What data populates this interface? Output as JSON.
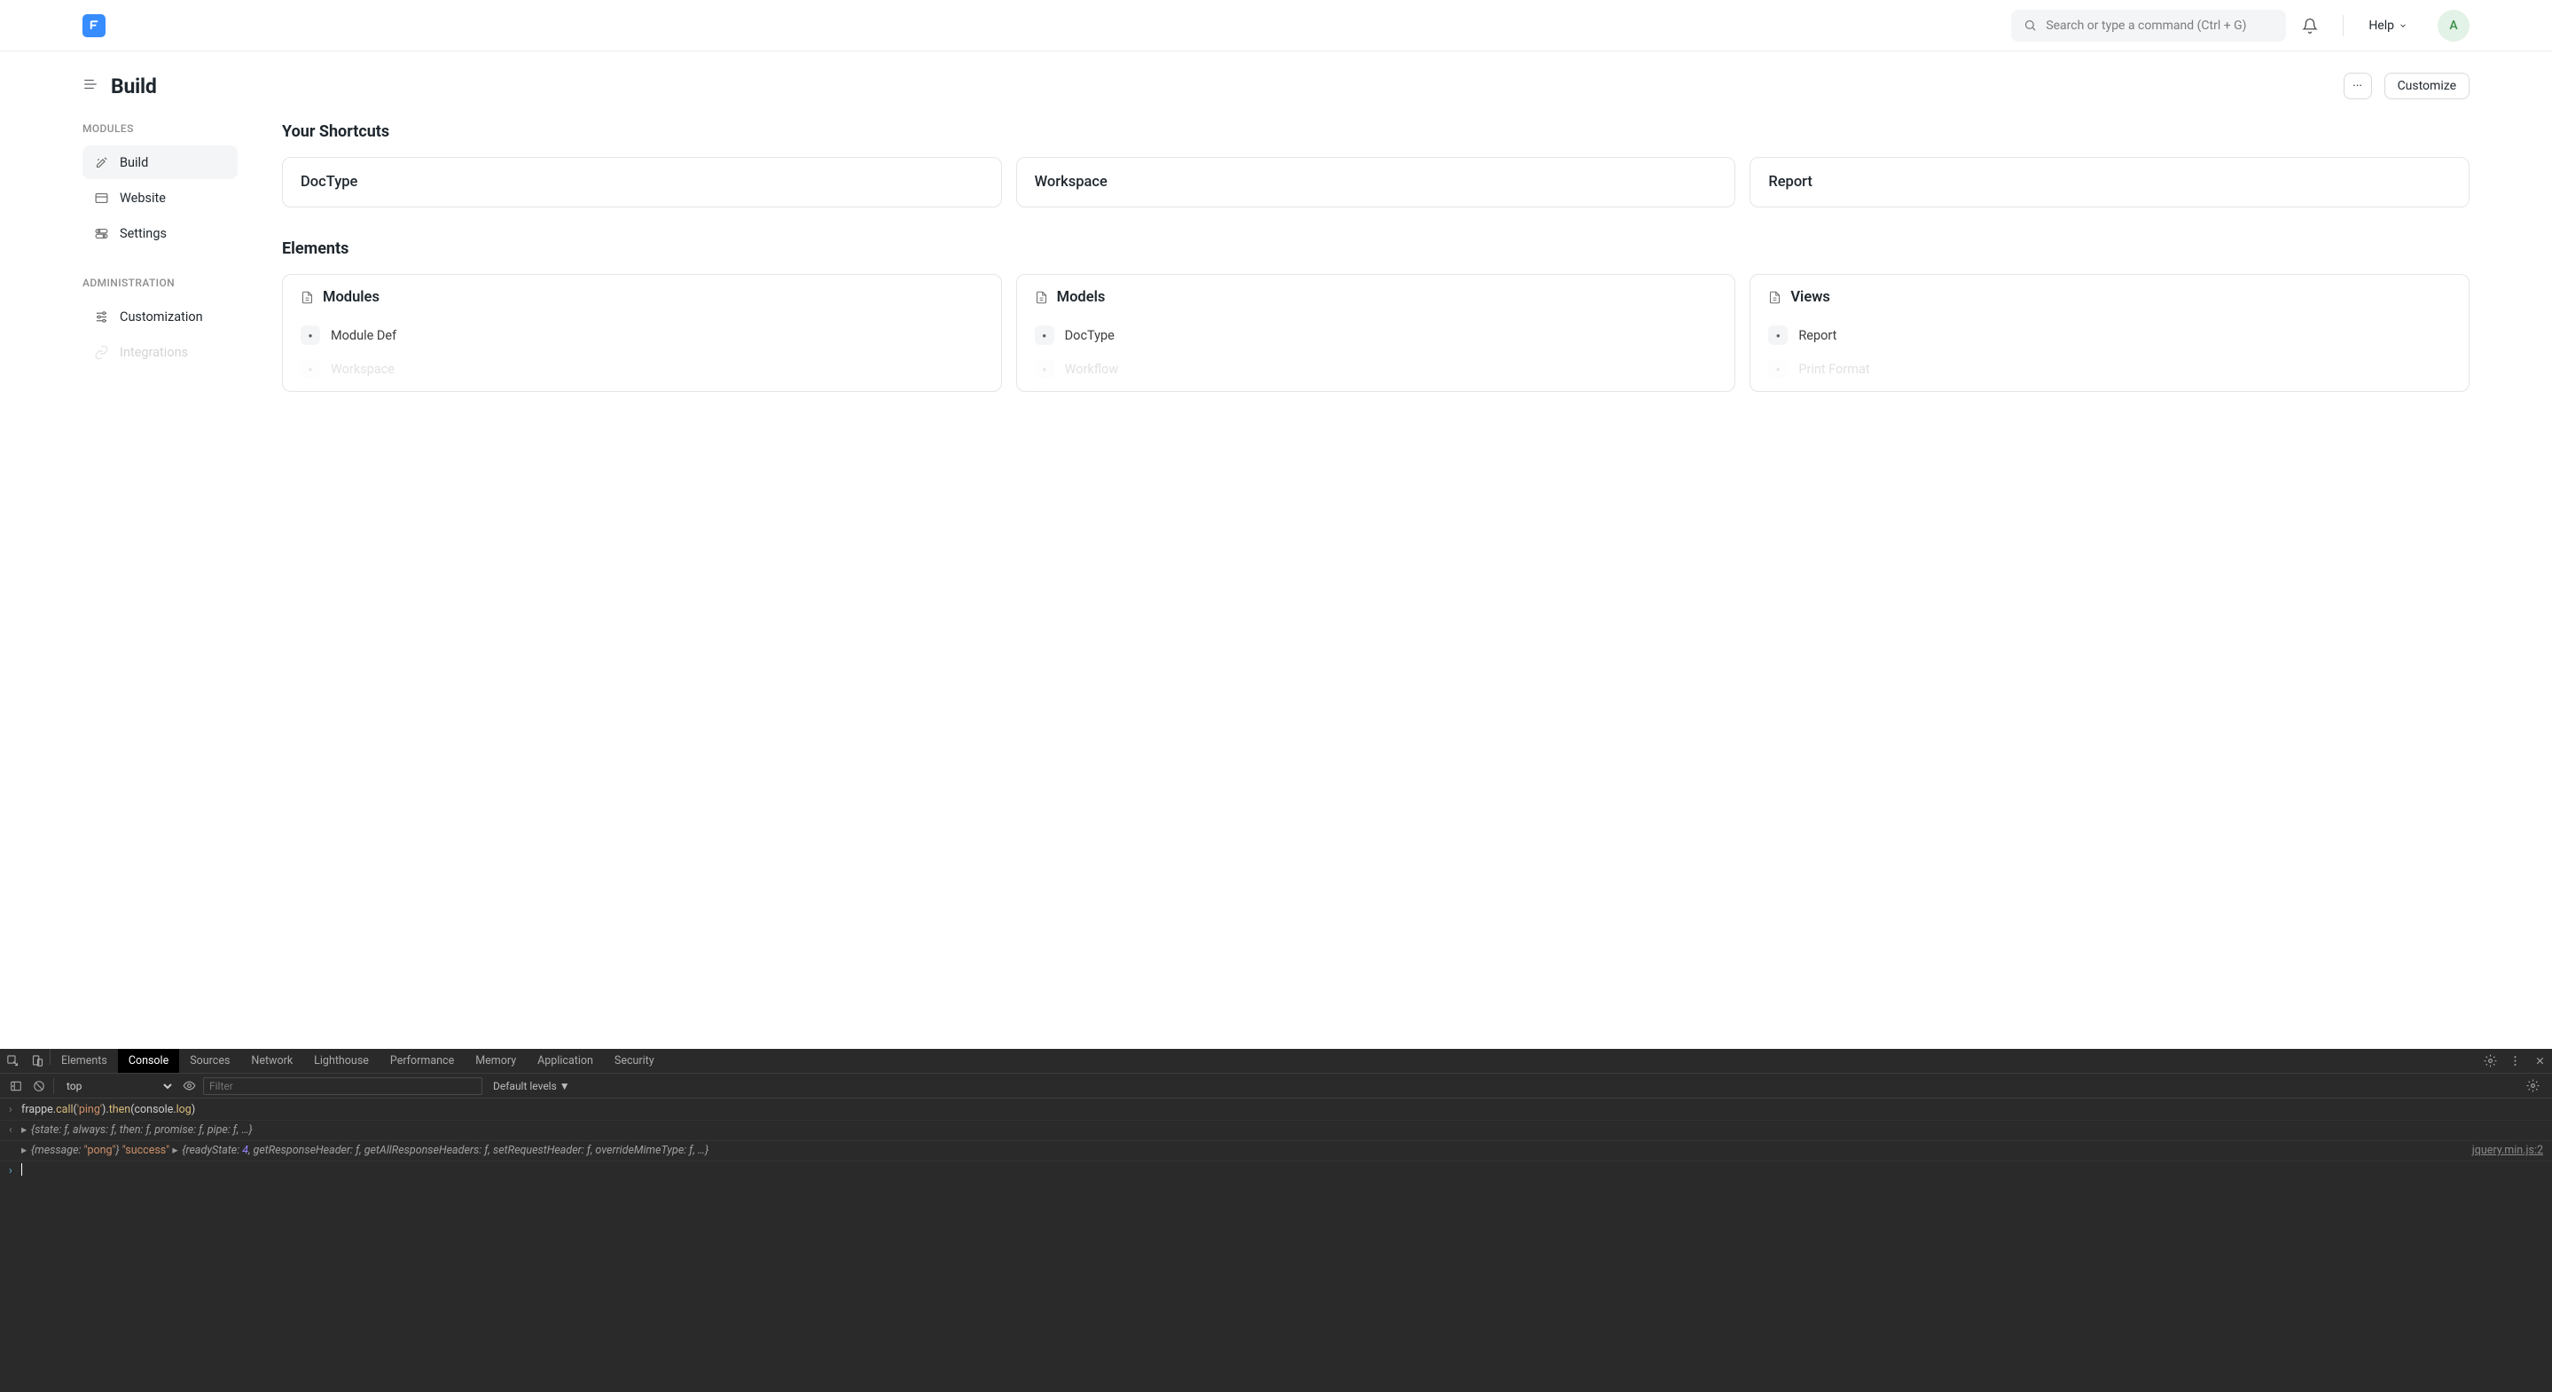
{
  "navbar": {
    "search_placeholder": "Search or type a command (Ctrl + G)",
    "help_label": "Help",
    "avatar_initial": "A"
  },
  "page": {
    "title": "Build",
    "more_label": "···",
    "customize_label": "Customize"
  },
  "sidebar": {
    "section_modules": "MODULES",
    "section_admin": "ADMINISTRATION",
    "items_modules": [
      {
        "label": "Build"
      },
      {
        "label": "Website"
      },
      {
        "label": "Settings"
      }
    ],
    "items_admin": [
      {
        "label": "Customization"
      },
      {
        "label": "Integrations"
      }
    ]
  },
  "shortcuts": {
    "title": "Your Shortcuts",
    "cards": [
      {
        "label": "DocType"
      },
      {
        "label": "Workspace"
      },
      {
        "label": "Report"
      }
    ]
  },
  "elements": {
    "title": "Elements",
    "cards": [
      {
        "title": "Modules",
        "items": [
          {
            "label": "Module Def"
          },
          {
            "label": "Workspace"
          }
        ]
      },
      {
        "title": "Models",
        "items": [
          {
            "label": "DocType"
          },
          {
            "label": "Workflow"
          }
        ]
      },
      {
        "title": "Views",
        "items": [
          {
            "label": "Report"
          },
          {
            "label": "Print Format"
          }
        ]
      }
    ]
  },
  "devtools": {
    "tabs": [
      "Elements",
      "Console",
      "Sources",
      "Network",
      "Lighthouse",
      "Performance",
      "Memory",
      "Application",
      "Security"
    ],
    "active_tab": "Console",
    "context": "top",
    "filter_placeholder": "Filter",
    "levels_label": "Default levels",
    "input_line": {
      "pre": "frappe.",
      "call": "call",
      "open_paren": "(",
      "arg": "'ping'",
      "close_paren": ")",
      "dot_then": ".",
      "then": "then",
      "open2": "(",
      "console": "console.",
      "log": "log",
      "close2": ")"
    },
    "deferred_line": "{state: ƒ, always: ƒ, then: ƒ, promise: ƒ, pipe: ƒ, …}",
    "response_msg": "{message: \"pong\"}",
    "response_status": "\"success\"",
    "xhr_line": "{readyState: 4, getResponseHeader: ƒ, getAllResponseHeaders: ƒ, setRequestHeader: ƒ, overrideMimeType: ƒ, …}",
    "source_link": "jquery.min.js:2"
  }
}
